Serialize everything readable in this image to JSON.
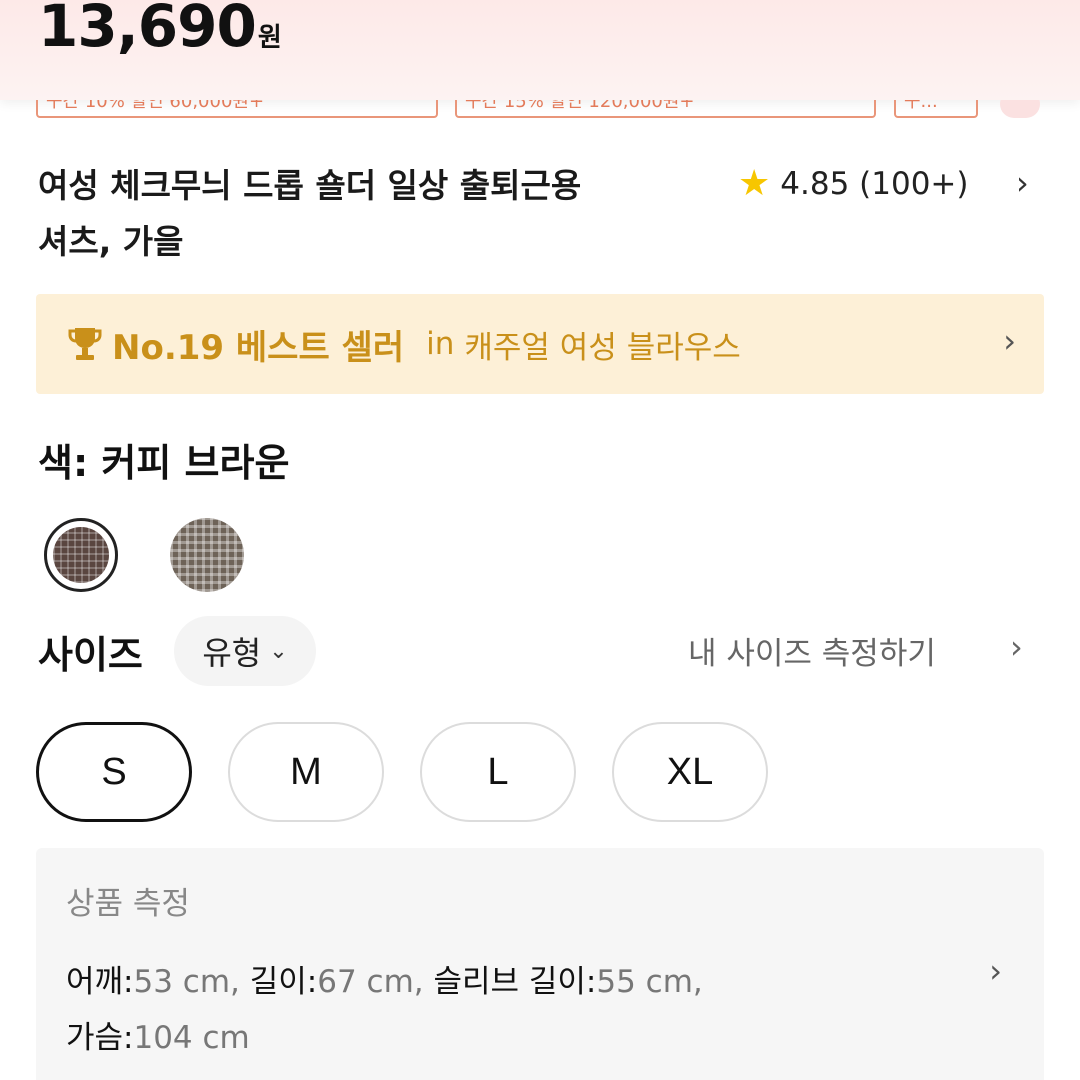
{
  "header": {
    "price_amount": "13,690",
    "price_unit": "원",
    "coupons": [
      "구간 10% 할인 60,000원+",
      "구간 15% 할인 120,000원+",
      "구..."
    ]
  },
  "product": {
    "title_line1": "여성 체크무늬 드롭 숄더 일상 출퇴근용",
    "title_line2": "셔츠, 가을",
    "rating": "4.85 (100+)"
  },
  "best_seller": {
    "rank": "No.19 베스트 셀러",
    "in": "in",
    "category": "캐주얼 여성 블라우스"
  },
  "color": {
    "label": "색: 커피 브라운",
    "swatches": [
      "coffee-brown",
      "checked-khaki"
    ]
  },
  "size": {
    "label": "사이즈",
    "type_label": "유형",
    "measure_link": "내 사이즈 측정하기",
    "options": [
      "S",
      "M",
      "L",
      "XL"
    ],
    "selected": "S"
  },
  "measurement": {
    "title": "상품 측정",
    "shoulder_key": "어깨:",
    "shoulder_val": "53 cm, ",
    "length_key": "길이:",
    "length_val": "67 cm, ",
    "sleeve_key": "슬리브 길이:",
    "sleeve_val": "55 cm,",
    "chest_key": "가슴:",
    "chest_val": "104 cm"
  },
  "icons": {
    "star": "star-icon",
    "trophy": "trophy-icon",
    "chevron": "chevron-right-icon"
  },
  "colors": {
    "accent": "#c9901a",
    "banner_bg": "#fdf0d7",
    "header_bg": "#fde9e8",
    "star": "#f7c600"
  }
}
